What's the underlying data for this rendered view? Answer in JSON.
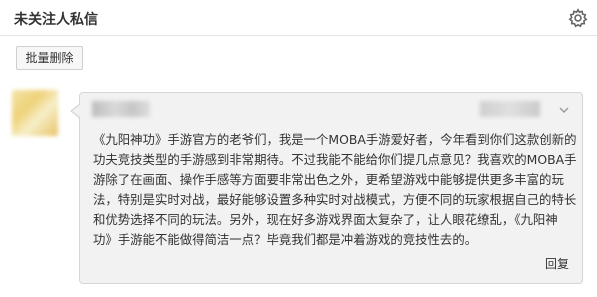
{
  "header": {
    "title": "未关注人私信",
    "settings_icon": "gear-icon"
  },
  "toolbar": {
    "batch_delete_label": "批量删除"
  },
  "message": {
    "lines": [
      "《九阳神功》手游官方的老爷们，我是一个MOBA手游爱好者，今年看到你们这款创新的",
      "功夫竞技类型的手游感到非常期待。不过我能不能给你们提几点意见？我喜欢的MOBA手",
      "游除了在画面、操作手感等方面要非常出色之外，更希望游戏中能够提供更多丰富的玩",
      "法，特别是实时对战，最好能够设置多种实时对战模式，方便不同的玩家根据自己的特长",
      "和优势选择不同的玩法。另外，现在好多游戏界面太复杂了，让人眼花缭乱，《九阳神",
      "功》手游能不能做得简洁一点？毕竟我们都是冲着游戏的竞技性去的。"
    ],
    "reply_label": "回复",
    "expand_icon": "chevron-down-icon"
  },
  "colors": {
    "bubble_bg": "#f2f2f2",
    "border": "#d6d6d6",
    "text": "#333333"
  }
}
